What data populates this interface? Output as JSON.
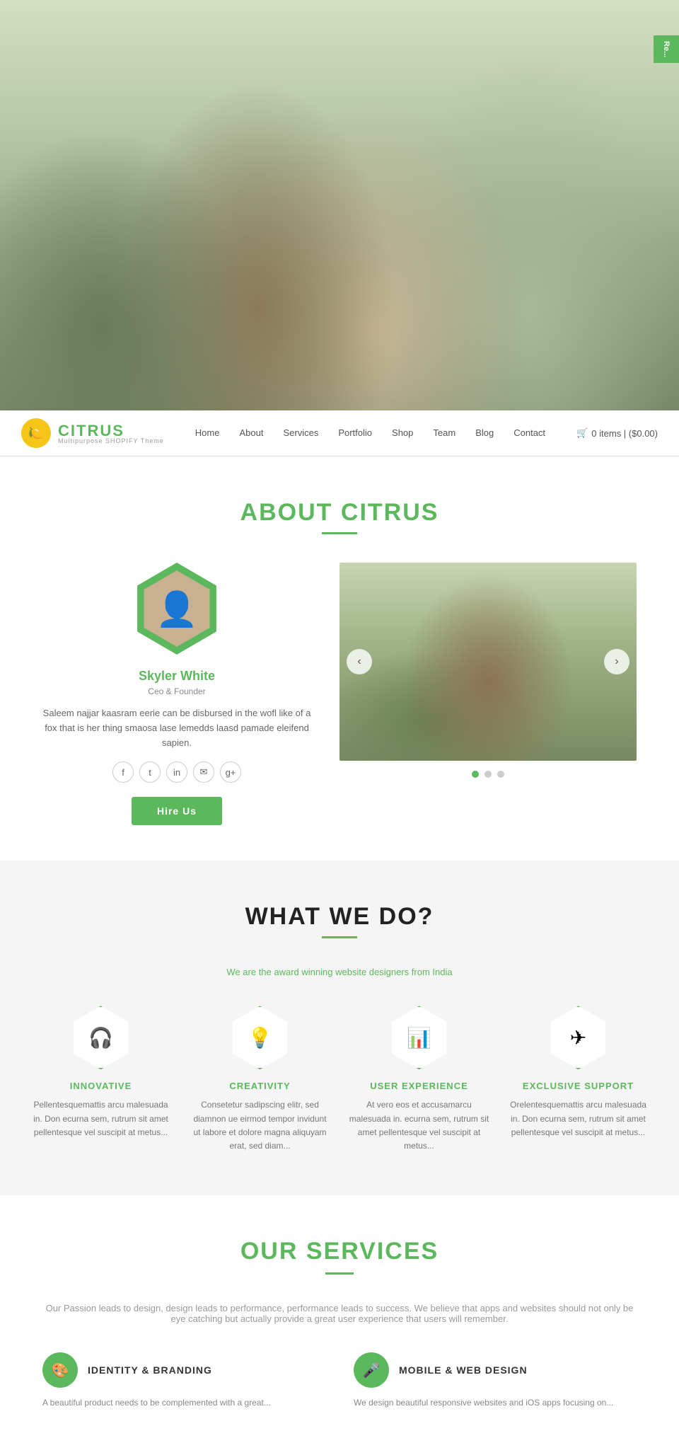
{
  "hero": {
    "badge": "Re..."
  },
  "navbar": {
    "logo_text_normal": "CIT",
    "logo_text_colored": "RUS",
    "logo_sub": "Multipurpose SHOPIFY Theme",
    "nav_items": [
      {
        "label": "Home",
        "href": "#"
      },
      {
        "label": "About",
        "href": "#"
      },
      {
        "label": "Services",
        "href": "#"
      },
      {
        "label": "Portfolio",
        "href": "#"
      },
      {
        "label": "Shop",
        "href": "#"
      },
      {
        "label": "Team",
        "href": "#"
      },
      {
        "label": "Blog",
        "href": "#"
      },
      {
        "label": "Contact",
        "href": "#"
      }
    ],
    "cart_label": "0 items | ($0.00)"
  },
  "about_section": {
    "title_normal": "ABOUT",
    "title_colored": "CITRUS",
    "person_name": "Skyler White",
    "person_title": "Ceo & Founder",
    "person_bio": "Saleem najjar kaasram eerie can be disbursed in the wofl like of a fox that is her thing smaosa lase lemedds laasd pamade eleifend sapien.",
    "hire_btn": "Hire Us",
    "social_icons": [
      "f",
      "t",
      "in",
      "✉",
      "g+"
    ],
    "slide_dots": 3
  },
  "what_we_do": {
    "title": "WHAT WE DO?",
    "subtitle": "We are the award winning website designers from India",
    "services": [
      {
        "icon": "🎧",
        "title": "INNOVATIVE",
        "desc": "Pellentesquemattis arcu malesuada in. Don ecurna sem, rutrum sit amet pellentesque vel suscipit at metus..."
      },
      {
        "icon": "💡",
        "title": "CREATIVITY",
        "desc": "Consetetur sadipscing elitr, sed diamnon ue eirmod tempor invidunt ut labore et dolore magna aliquyam erat, sed diam..."
      },
      {
        "icon": "📊",
        "title": "USER EXPERIENCE",
        "desc": "At vero eos et accusamarcu malesuada in. ecurna sem, rutrum sit amet pellentesque vel suscipit at metus..."
      },
      {
        "icon": "✈",
        "title": "EXCLUSIVE SUPPORT",
        "desc": "Orelentesquemattis arcu malesuada in. Don ecurna sem, rutrum sit amet pellentesque vel suscipit at metus..."
      }
    ]
  },
  "our_services": {
    "title_normal": "OUR",
    "title_colored": "SERVICES",
    "subtitle": "Our Passion leads to design, design leads to performance, performance leads to success. We believe that apps and websites should not only be eye catching but actually provide a great user experience that users will remember.",
    "services": [
      {
        "icon": "🎨",
        "title": "IDENTITY & BRANDING",
        "desc": "A beautiful product needs to be complemented with a great..."
      },
      {
        "icon": "🎤",
        "title": "MOBILE & WEB DESIGN",
        "desc": "We design beautiful responsive websites and iOS apps focusing on..."
      }
    ]
  }
}
